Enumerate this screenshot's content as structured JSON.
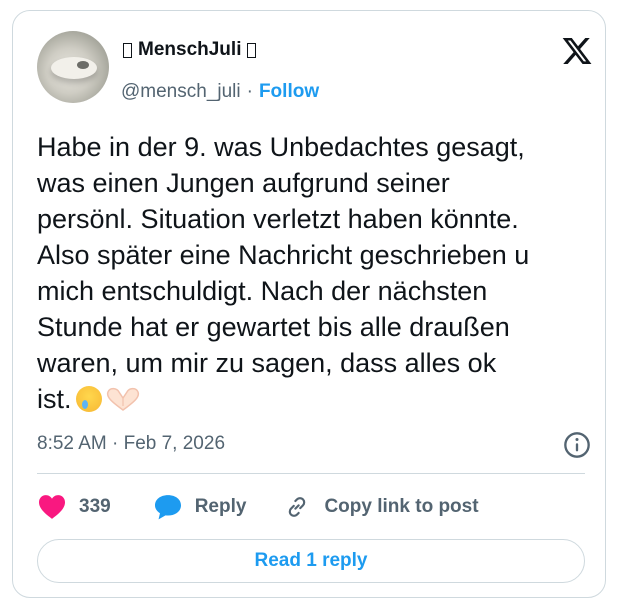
{
  "author": {
    "display_name": "MenschJuli",
    "handle": "@mensch_juli",
    "separator": "·",
    "follow_label": "Follow"
  },
  "tweet": {
    "text": "Habe in der 9. was Unbedachtes gesagt,\nwas einen Jungen aufgrund seiner\npersönl. Situation verletzt haben könnte.\nAlso später eine Nachricht geschrieben u\nmich entschuldigt. Nach der nächsten\nStunde hat er gewartet bis alle draußen\nwaren, um mir zu sagen, dass alles ok\nist.",
    "timestamp": "8:52 AM · Feb 7, 2026"
  },
  "actions": {
    "like_count": "339",
    "reply_label": "Reply",
    "copy_link_label": "Copy link to post"
  },
  "read_replies_label": "Read 1 reply",
  "icons": {
    "logo": "x-logo-icon",
    "info": "info-icon",
    "like": "heart-icon",
    "reply": "speech-bubble-icon",
    "copy": "link-icon"
  },
  "colors": {
    "accent": "#1d9bf0",
    "like": "#f91880",
    "text": "#0f1419",
    "muted": "#536471",
    "border": "#cfd9de"
  }
}
